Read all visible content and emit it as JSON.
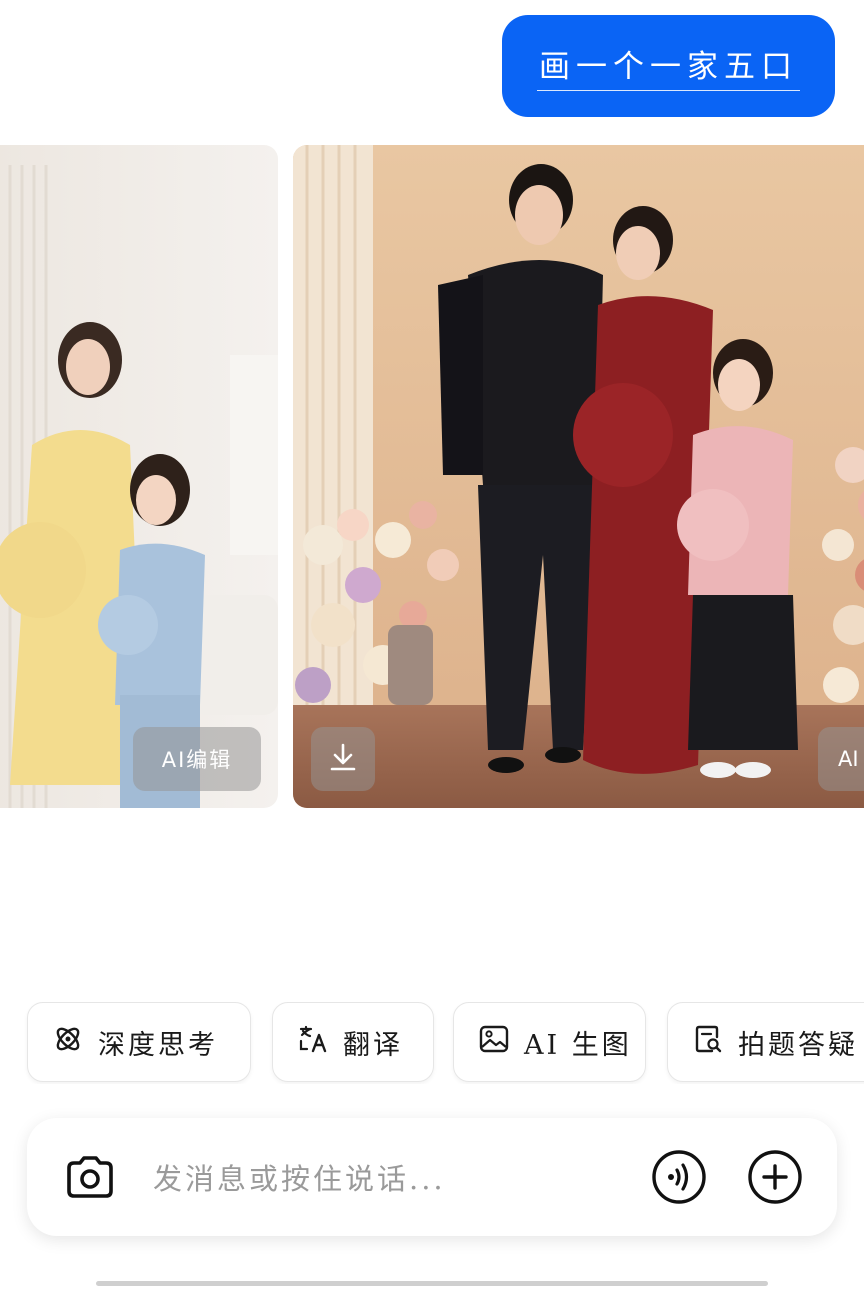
{
  "message": {
    "text": "画一个一家五口"
  },
  "images": {
    "left_card": {
      "edit_label": "AI编辑"
    },
    "main_card": {
      "download_icon": "download-icon"
    },
    "right_card": {
      "edit_label_partial": "AI"
    }
  },
  "quick_actions": [
    {
      "label": "深度思考",
      "icon": "atom-icon"
    },
    {
      "label": "翻译",
      "icon": "translate-icon"
    },
    {
      "label": "AI 生图",
      "icon": "image-icon"
    },
    {
      "label": "拍题答疑",
      "icon": "document-search-icon"
    }
  ],
  "input": {
    "placeholder": "发消息或按住说话...",
    "camera_icon": "camera-icon",
    "voice_icon": "voice-icon",
    "plus_icon": "plus-icon"
  },
  "colors": {
    "bubble": "#0a64f5",
    "chip_border": "#e6e6e6",
    "placeholder": "#9a9a9a"
  }
}
